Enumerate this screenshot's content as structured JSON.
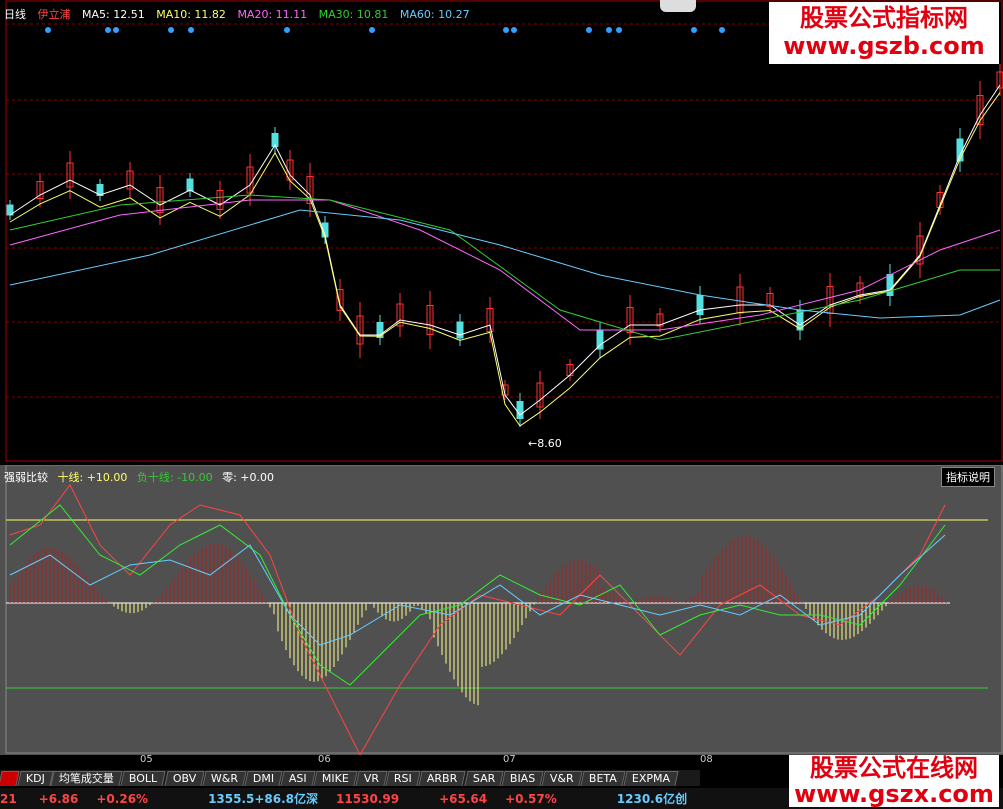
{
  "header": {
    "period": "日线",
    "stock_name": "伊立浦",
    "ma": [
      {
        "label": "MA5: 12.51",
        "color": "#ffffff"
      },
      {
        "label": "MA10: 11.82",
        "color": "#ffff66"
      },
      {
        "label": "MA20: 11.11",
        "color": "#ff66ff"
      },
      {
        "label": "MA30: 10.81",
        "color": "#33cc33"
      },
      {
        "label": "MA60: 10.27",
        "color": "#66ccff"
      }
    ]
  },
  "main_chart": {
    "price_low_label": "8.60"
  },
  "indicator": {
    "name": "强弱比较",
    "params": [
      {
        "label": "十线: +10.00",
        "color": "#ffff66"
      },
      {
        "label": "负十线: -10.00",
        "color": "#33cc33"
      },
      {
        "label": "零: +0.00",
        "color": "#ffffff"
      }
    ],
    "help_button": "指标说明"
  },
  "date_axis": [
    "05",
    "06",
    "07",
    "08"
  ],
  "tabs": [
    "KDJ",
    "均笔成交量",
    "BOLL",
    "OBV",
    "W&R",
    "DMI",
    "ASI",
    "MIKE",
    "VR",
    "RSI",
    "ARBR",
    "SAR",
    "BIAS",
    "V&R",
    "BETA",
    "EXPMA"
  ],
  "status_bar": [
    {
      "text": "21",
      "color": "#ff4444"
    },
    {
      "text": "+6.86",
      "color": "#ff4444"
    },
    {
      "text": "+0.26%",
      "color": "#ff4444"
    },
    {
      "text": "1355.5+86.8亿深",
      "color": "#66ccff"
    },
    {
      "text": "11530.99",
      "color": "#ff4444"
    },
    {
      "text": "+65.64",
      "color": "#ff4444"
    },
    {
      "text": "+0.57%",
      "color": "#ff4444"
    },
    {
      "text": "1230.6亿创",
      "color": "#66ccff"
    }
  ],
  "watermark_top": [
    "股票公式指标网",
    "www.gszb.com"
  ],
  "watermark_bottom": [
    "股票公式在线网",
    "www.gszx.com"
  ]
}
